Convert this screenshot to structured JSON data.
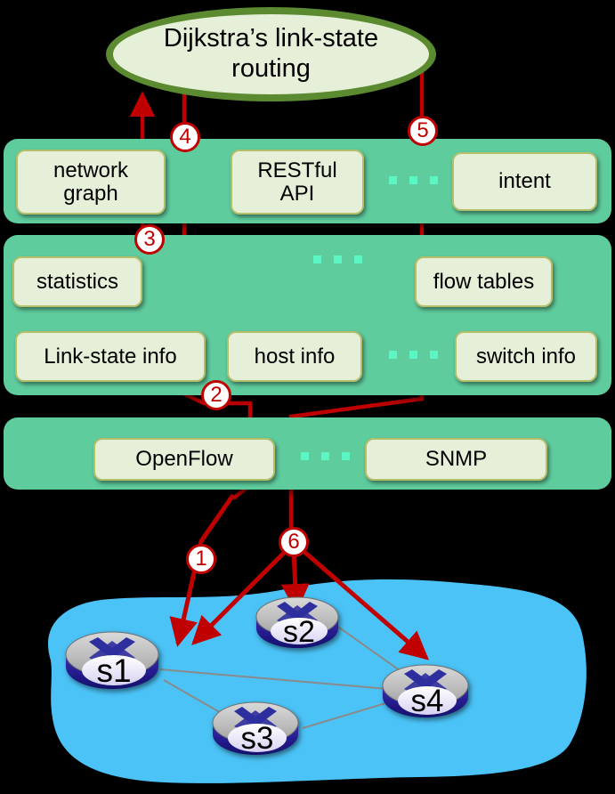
{
  "diagram": {
    "title": "Dijkstra's link-state routing",
    "title_line1": "Dijkstra’s link-state",
    "title_line2": "routing",
    "background_color": "#000000",
    "layer_band_color": "#5fcc9e",
    "module_fill_color": "#e6efd7",
    "module_border_color": "#b5bf6a",
    "arrow_color": "#c00000",
    "ellipsis_dot_color": "#5cf5c4",
    "cloud_color": "#4cc3f7"
  },
  "application_layer": {
    "modules": [
      {
        "label": "network\ngraph",
        "line1": "network",
        "line2": "graph"
      },
      {
        "label": "RESTful\nAPI",
        "line1": "RESTful",
        "line2": "API"
      },
      {
        "label": "intent"
      }
    ],
    "ellipsis": "..."
  },
  "core_layer": {
    "modules_top": [
      {
        "label": "statistics"
      },
      {
        "label": "flow tables"
      }
    ],
    "modules_bottom": [
      {
        "label": "Link-state info"
      },
      {
        "label": "host info"
      },
      {
        "label": "switch info"
      }
    ],
    "ellipsis": "..."
  },
  "southbound_layer": {
    "modules": [
      {
        "label": "OpenFlow"
      },
      {
        "label": "SNMP"
      }
    ],
    "ellipsis": "..."
  },
  "steps": [
    {
      "id": "1",
      "label": "1"
    },
    {
      "id": "2",
      "label": "2"
    },
    {
      "id": "3",
      "label": "3"
    },
    {
      "id": "4",
      "label": "4"
    },
    {
      "id": "5",
      "label": "5"
    },
    {
      "id": "6",
      "label": "6"
    }
  ],
  "network": {
    "switches": [
      {
        "id": "s1",
        "label": "s1"
      },
      {
        "id": "s2",
        "label": "s2"
      },
      {
        "id": "s3",
        "label": "s3"
      },
      {
        "id": "s4",
        "label": "s4"
      }
    ],
    "links": [
      {
        "from": "s1",
        "to": "s4"
      },
      {
        "from": "s1",
        "to": "s3"
      },
      {
        "from": "s2",
        "to": "s4"
      },
      {
        "from": "s3",
        "to": "s4"
      }
    ]
  }
}
